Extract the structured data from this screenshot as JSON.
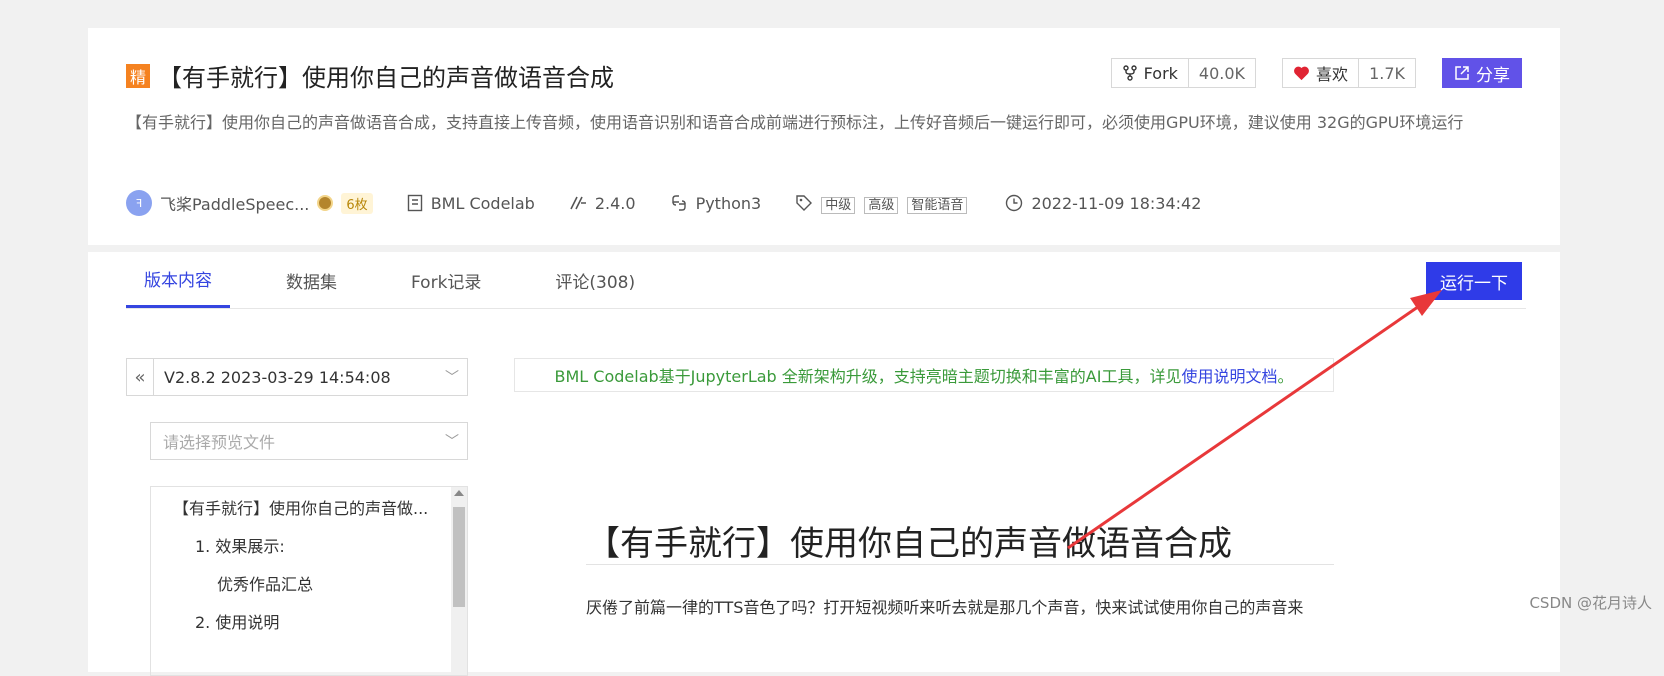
{
  "header": {
    "badge": "精",
    "title": "【有手就行】使用你自己的声音做语音合成",
    "fork_label": "Fork",
    "fork_count": "40.0K",
    "like_label": "喜欢",
    "like_count": "1.7K",
    "share_label": "分享",
    "description": "【有手就行】使用你自己的声音做语音合成，支持直接上传音频，使用语音识别和语音合成前端进行预标注，上传好音频后一键运行即可，必须使用GPU环境，建议使用 32G的GPU环境运行"
  },
  "meta": {
    "author": "飞桨PaddleSpeec...",
    "avatar_text": "ꟻ",
    "count_badge": "6枚",
    "env": "BML Codelab",
    "version": "2.4.0",
    "language": "Python3",
    "tags": [
      "中级",
      "高级",
      "智能语音"
    ],
    "datetime": "2022-11-09 18:34:42"
  },
  "tabs": [
    {
      "label": "版本内容"
    },
    {
      "label": "数据集"
    },
    {
      "label": "Fork记录"
    },
    {
      "label": "评论(308)"
    }
  ],
  "run_label": "运行一下",
  "version_select": "V2.8.2 2023-03-29 14:54:08",
  "file_select_placeholder": "请选择预览文件",
  "toc": [
    "【有手就行】使用你自己的声音做...",
    "1. 效果展示:",
    "优秀作品汇总",
    "2. 使用说明"
  ],
  "notice": {
    "text": "BML Codelab基于JupyterLab 全新架构升级，支持亮暗主题切换和丰富的AI工具，详见",
    "link": "使用说明文档",
    "end": "。"
  },
  "doc": {
    "title": "【有手就行】使用你自己的声音做语音合成",
    "paragraph": "厌倦了前篇一律的TTS音色了吗？打开短视频听来听去就是那几个声音，快来试试使用你自己的声音来"
  },
  "watermark": "CSDN @花月诗人",
  "colors": {
    "accent": "#2f3be8",
    "share": "#6152e8",
    "badge": "#f58220",
    "annotation_arrow": "#e8383a"
  }
}
